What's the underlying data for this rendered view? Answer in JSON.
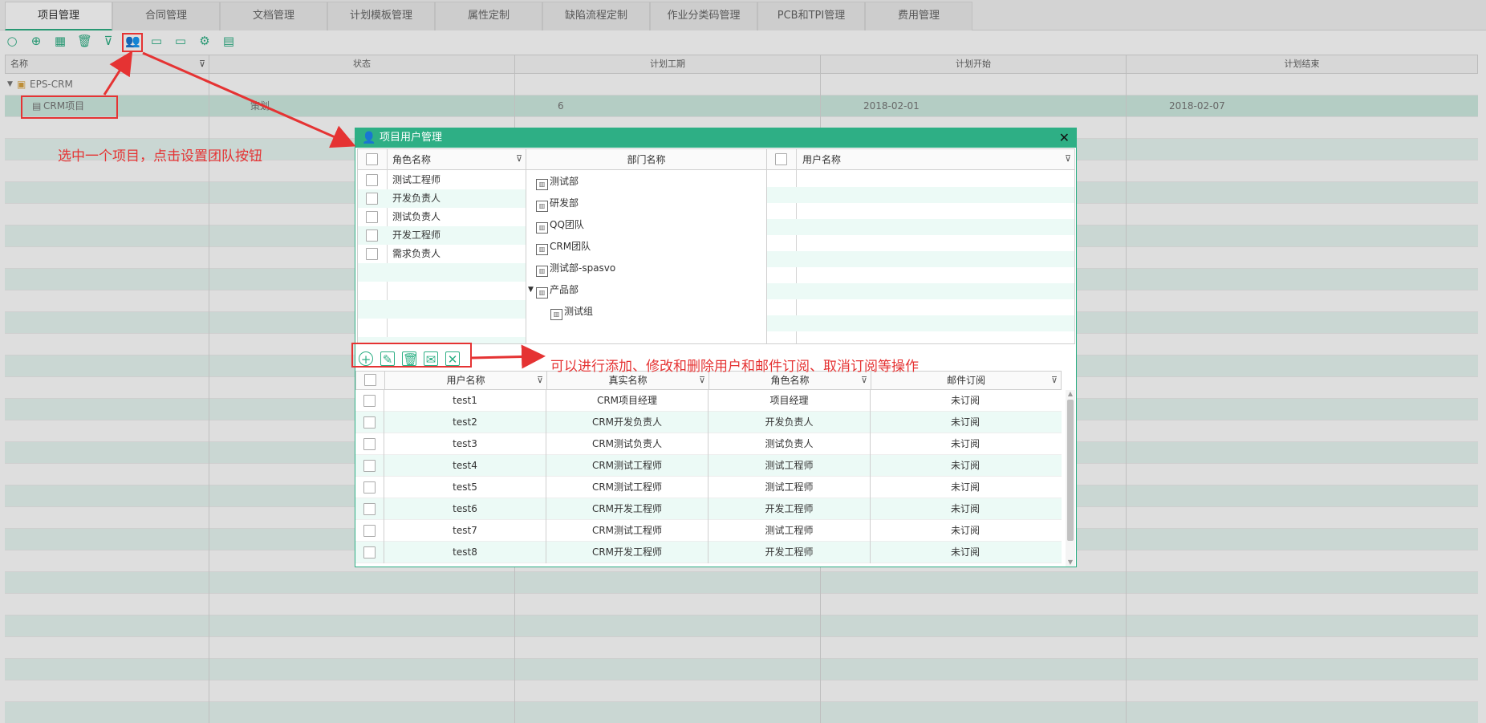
{
  "tabs": [
    "项目管理",
    "合同管理",
    "文档管理",
    "计划模板管理",
    "属性定制",
    "缺陷流程定制",
    "作业分类码管理",
    "PCB和TPI管理",
    "费用管理"
  ],
  "toolbar_icons": [
    "refresh-icon",
    "add-icon",
    "hierarchy-icon",
    "delete-icon",
    "filter-icon",
    "team-settings-icon",
    "export-icon",
    "import-icon",
    "settings-icon",
    "report-icon"
  ],
  "grid": {
    "headers": [
      "名称",
      "状态",
      "计划工期",
      "计划开始",
      "计划结束"
    ],
    "tree_root": "EPS-CRM",
    "project": {
      "name": "CRM项目",
      "status": "策划",
      "duration": "6",
      "start": "2018-02-01",
      "end": "2018-02-07"
    }
  },
  "annotations": {
    "step1": "选中一个项目，点击设置团队按钮",
    "step2": "可以进行添加、修改和删除用户和邮件订阅、取消订阅等操作",
    "color": "#e53333"
  },
  "dialog": {
    "title": "项目用户管理",
    "close": "✕",
    "role_panel": {
      "header": "角色名称",
      "roles": [
        "测试工程师",
        "开发负责人",
        "测试负责人",
        "开发工程师",
        "需求负责人"
      ]
    },
    "dept_panel": {
      "header": "部门名称",
      "departments": [
        {
          "name": "测试部",
          "level": 0
        },
        {
          "name": "研发部",
          "level": 0
        },
        {
          "name": "QQ团队",
          "level": 0
        },
        {
          "name": "CRM团队",
          "level": 0
        },
        {
          "name": "测试部-spasvo",
          "level": 0
        },
        {
          "name": "产品部",
          "level": 0,
          "expanded": true
        },
        {
          "name": "测试组",
          "level": 1
        }
      ]
    },
    "user_panel": {
      "header": "用户名称"
    },
    "action_icons": [
      "add-user-icon",
      "edit-user-icon",
      "delete-user-icon",
      "subscribe-mail-icon",
      "unsubscribe-mail-icon"
    ],
    "user_table": {
      "headers": [
        "用户名称",
        "真实名称",
        "角色名称",
        "邮件订阅"
      ],
      "rows": [
        [
          "test1",
          "CRM项目经理",
          "项目经理",
          "未订阅"
        ],
        [
          "test2",
          "CRM开发负责人",
          "开发负责人",
          "未订阅"
        ],
        [
          "test3",
          "CRM测试负责人",
          "测试负责人",
          "未订阅"
        ],
        [
          "test4",
          "CRM测试工程师",
          "测试工程师",
          "未订阅"
        ],
        [
          "test5",
          "CRM测试工程师",
          "测试工程师",
          "未订阅"
        ],
        [
          "test6",
          "CRM开发工程师",
          "开发工程师",
          "未订阅"
        ],
        [
          "test7",
          "CRM测试工程师",
          "测试工程师",
          "未订阅"
        ],
        [
          "test8",
          "CRM开发工程师",
          "开发工程师",
          "未订阅"
        ]
      ]
    }
  },
  "colors": {
    "accent": "#2eaf85",
    "annotation": "#e53333"
  }
}
